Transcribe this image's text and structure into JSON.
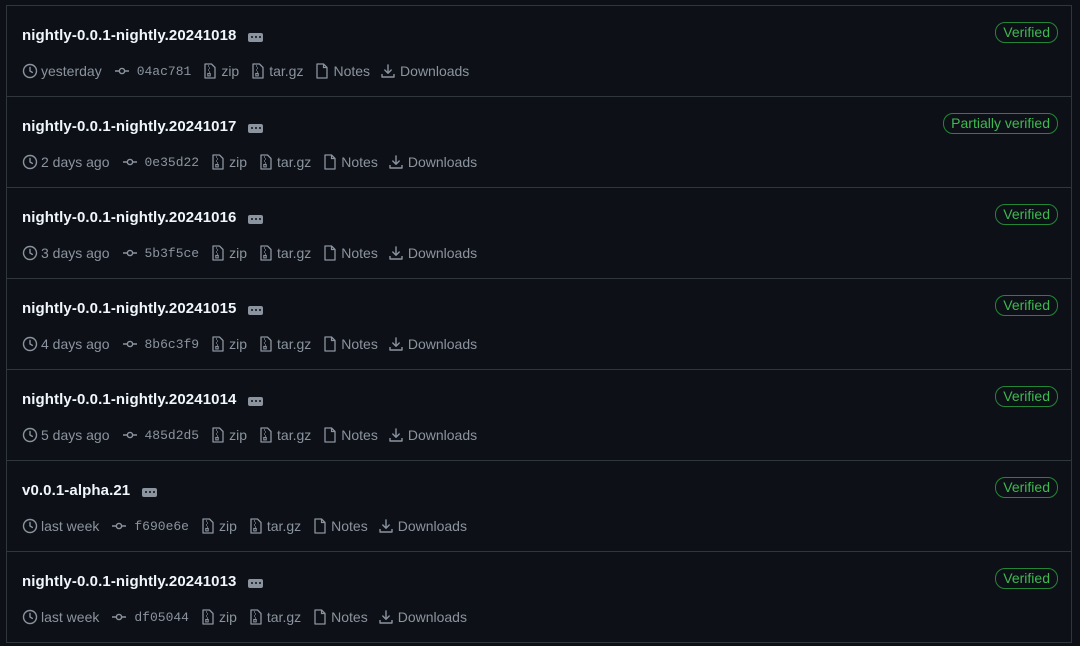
{
  "icons": {
    "time": "clock-icon",
    "commit": "git-commit-icon",
    "zip": "file-zip-icon",
    "targz": "file-zip-icon",
    "notes": "file-icon",
    "downloads": "download-icon",
    "menu": "kebab-horizontal-icon"
  },
  "colors": {
    "background": "#0d1117",
    "border": "#30363d",
    "verified": "#3fb950",
    "muted": "#8b949e"
  },
  "releases": [
    {
      "tag": "nightly-0.0.1-nightly.20241018",
      "badge": "Verified",
      "time": "yesterday",
      "sha": "04ac781",
      "zip": "zip",
      "targz": "tar.gz",
      "notes": "Notes",
      "downloads": "Downloads"
    },
    {
      "tag": "nightly-0.0.1-nightly.20241017",
      "badge": "Partially verified",
      "time": "2 days ago",
      "sha": "0e35d22",
      "zip": "zip",
      "targz": "tar.gz",
      "notes": "Notes",
      "downloads": "Downloads"
    },
    {
      "tag": "nightly-0.0.1-nightly.20241016",
      "badge": "Verified",
      "time": "3 days ago",
      "sha": "5b3f5ce",
      "zip": "zip",
      "targz": "tar.gz",
      "notes": "Notes",
      "downloads": "Downloads"
    },
    {
      "tag": "nightly-0.0.1-nightly.20241015",
      "badge": "Verified",
      "time": "4 days ago",
      "sha": "8b6c3f9",
      "zip": "zip",
      "targz": "tar.gz",
      "notes": "Notes",
      "downloads": "Downloads"
    },
    {
      "tag": "nightly-0.0.1-nightly.20241014",
      "badge": "Verified",
      "time": "5 days ago",
      "sha": "485d2d5",
      "zip": "zip",
      "targz": "tar.gz",
      "notes": "Notes",
      "downloads": "Downloads"
    },
    {
      "tag": "v0.0.1-alpha.21",
      "badge": "Verified",
      "time": "last week",
      "sha": "f690e6e",
      "zip": "zip",
      "targz": "tar.gz",
      "notes": "Notes",
      "downloads": "Downloads"
    },
    {
      "tag": "nightly-0.0.1-nightly.20241013",
      "badge": "Verified",
      "time": "last week",
      "sha": "df05044",
      "zip": "zip",
      "targz": "tar.gz",
      "notes": "Notes",
      "downloads": "Downloads"
    }
  ]
}
